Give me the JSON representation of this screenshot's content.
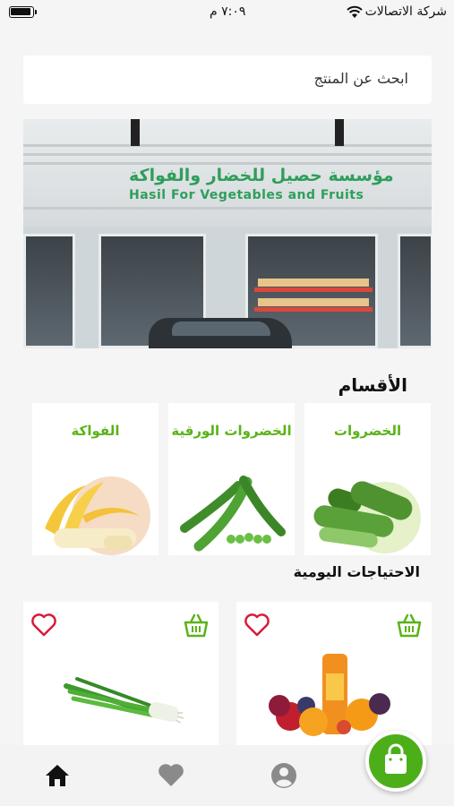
{
  "status_bar": {
    "carrier": "شركة الاتصالات",
    "time": "٧:٠٩ م",
    "battery_level": 0.95
  },
  "search": {
    "placeholder": "ابحث عن المنتج"
  },
  "banner": {
    "sign_arabic": "مؤسسة حصيل للخضار والفواكة",
    "sign_english": "Hasil For Vegetables and Fruits"
  },
  "categories": {
    "title": "الأقسام",
    "items": [
      {
        "label": "الخضروات",
        "image": "cucumbers"
      },
      {
        "label": "الخضروات الورقية",
        "image": "green-peas"
      },
      {
        "label": "الفواكة",
        "image": "bananas"
      }
    ]
  },
  "daily_needs": {
    "title": "الاحتياجات اليومية",
    "items": [
      {
        "image": "mixed-fruits-juice"
      },
      {
        "image": "green-onions"
      }
    ]
  },
  "bottom_nav": {
    "items": [
      "home-icon",
      "heart-icon",
      "profile-icon"
    ],
    "fab": "shopping-bag-icon"
  },
  "colors": {
    "accent_green": "#5bb318",
    "heart_red": "#d81b3b",
    "fab_green": "#4caf1a",
    "nav_active": "#111111",
    "nav_inactive": "#8a8a8a"
  }
}
